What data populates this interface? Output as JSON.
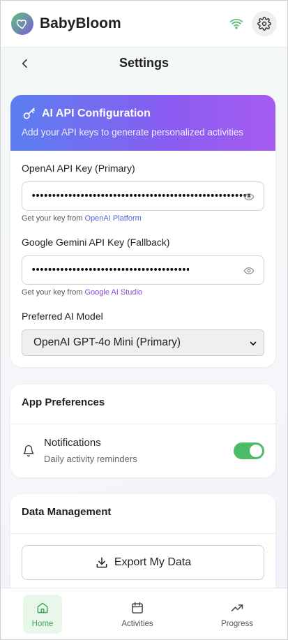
{
  "header": {
    "app_title": "BabyBloom",
    "icons": {
      "logo": "heart-icon",
      "network": "wifi-icon",
      "settings": "gear-icon"
    },
    "brand_color": "#5fbf7a"
  },
  "page": {
    "title": "Settings",
    "back_icon": "chevron-left-icon"
  },
  "api_card": {
    "title": "AI API Configuration",
    "subtitle": "Add your API keys to generate personalized activities",
    "openai": {
      "label": "OpenAI API Key (Primary)",
      "value": "••••••••••••••••••••••••••••••••••••••••••••••••••••••",
      "help_prefix": "Get your key from ",
      "help_link": "OpenAI Platform"
    },
    "gemini": {
      "label": "Google Gemini API Key (Fallback)",
      "value": "•••••••••••••••••••••••••••••••••••••••",
      "help_prefix": "Get your key from ",
      "help_link": "Google AI Studio"
    },
    "model": {
      "label": "Preferred AI Model",
      "selected": "OpenAI GPT-4o Mini (Primary)"
    },
    "gradient_colors": [
      "#5b7ff0",
      "#a65cf0"
    ]
  },
  "preferences": {
    "title": "App Preferences",
    "notifications": {
      "title": "Notifications",
      "subtitle": "Daily activity reminders",
      "enabled": true
    },
    "toggle_color": "#4cbc68"
  },
  "data_management": {
    "title": "Data Management",
    "export_label": "Export My Data"
  },
  "nav": {
    "items": [
      {
        "label": "Home",
        "icon": "home-icon",
        "active": true
      },
      {
        "label": "Activities",
        "icon": "calendar-icon",
        "active": false
      },
      {
        "label": "Progress",
        "icon": "trending-up-icon",
        "active": false
      }
    ]
  }
}
